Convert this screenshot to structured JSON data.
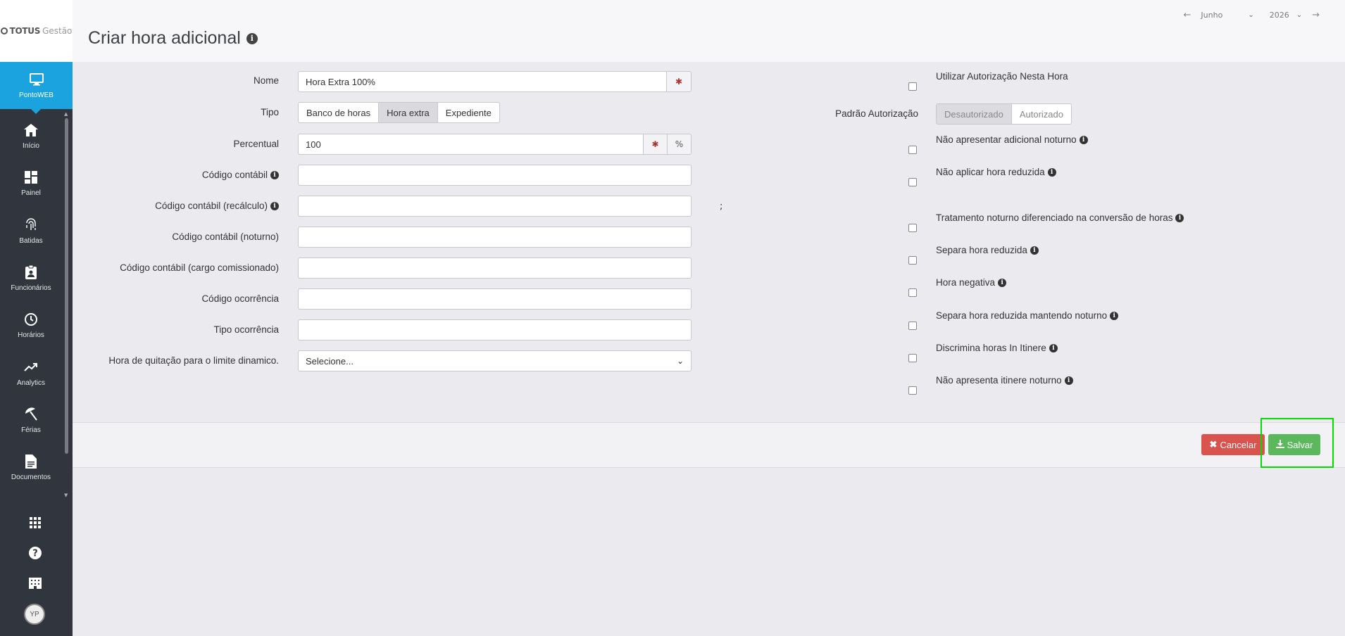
{
  "brand": {
    "totus": "TOTUS",
    "gestao": "Gestão"
  },
  "sidebar": {
    "active": {
      "label": "PontoWEB",
      "icon": "monitor-icon"
    },
    "items": [
      {
        "label": "Início",
        "icon": "home-icon"
      },
      {
        "label": "Painel",
        "icon": "dashboard-icon"
      },
      {
        "label": "Batidas",
        "icon": "fingerprint-icon"
      },
      {
        "label": "Funcionários",
        "icon": "badge-icon"
      },
      {
        "label": "Horários",
        "icon": "clock-icon"
      },
      {
        "label": "Analytics",
        "icon": "trending-up-icon"
      },
      {
        "label": "Férias",
        "icon": "beach-umbrella-icon"
      },
      {
        "label": "Documentos",
        "icon": "document-icon"
      }
    ],
    "bottom_icons": [
      "apps-grid-icon",
      "help-icon",
      "building-icon"
    ],
    "avatar": "YP"
  },
  "header": {
    "title": "Criar hora adicional",
    "month": "Junho",
    "year": "2026"
  },
  "form": {
    "nome": {
      "label": "Nome",
      "value": "Hora Extra 100%"
    },
    "tipo": {
      "label": "Tipo",
      "options": [
        "Banco de horas",
        "Hora extra",
        "Expediente"
      ],
      "selected": "Hora extra"
    },
    "percentual": {
      "label": "Percentual",
      "value": "100",
      "unit": "%"
    },
    "codigo_contabil": {
      "label": "Código contábil",
      "value": ""
    },
    "codigo_contabil_recalculo": {
      "label": "Código contábil (recálculo)",
      "value": ""
    },
    "codigo_contabil_noturno": {
      "label": "Código contábil (noturno)",
      "value": ""
    },
    "codigo_contabil_cargo": {
      "label": "Código contábil (cargo comissionado)",
      "value": ""
    },
    "codigo_ocorrencia": {
      "label": "Código ocorrência",
      "value": ""
    },
    "tipo_ocorrencia": {
      "label": "Tipo ocorrência",
      "value": ""
    },
    "hora_quitacao": {
      "label": "Hora de quitação para o limite dinamico.",
      "value": "Selecione..."
    },
    "semicolon": ";",
    "required_mark": "✱"
  },
  "right": {
    "utilizar_autorizacao": "Utilizar Autorização Nesta Hora",
    "padrao_autorizacao": {
      "label": "Padrão Autorização",
      "options": [
        "Desautorizado",
        "Autorizado"
      ],
      "selected": "Desautorizado"
    },
    "checks": [
      "Não apresentar adicional noturno",
      "Não aplicar hora reduzida",
      "Tratamento noturno diferenciado na conversão de horas",
      "Separa hora reduzida",
      "Hora negativa",
      "Separa hora reduzida mantendo noturno",
      "Discrimina horas In Itinere",
      "Não apresenta itinere noturno"
    ]
  },
  "footer": {
    "cancel": "Cancelar",
    "save": "Salvar"
  },
  "colors": {
    "accent": "#1aa3df",
    "danger": "#d9534f",
    "success": "#5cb85c",
    "sidebar": "#31353e"
  }
}
